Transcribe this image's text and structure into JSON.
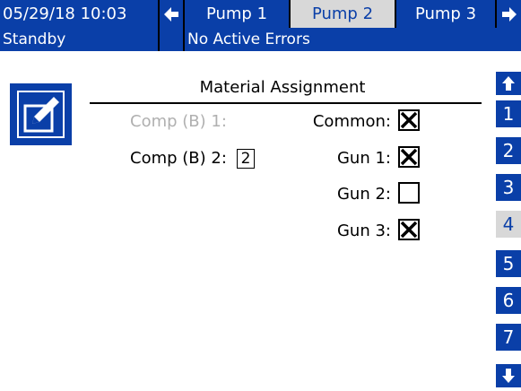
{
  "header": {
    "datetime": "05/29/18 10:03",
    "tabs": [
      {
        "label": "Pump 1",
        "active": false
      },
      {
        "label": "Pump 2",
        "active": true
      },
      {
        "label": "Pump 3",
        "active": false
      }
    ]
  },
  "status": {
    "mode": "Standby",
    "errors": "No Active Errors"
  },
  "page": {
    "title": "Material Assignment"
  },
  "fields": {
    "comp_b1_label": "Comp (B) 1:",
    "comp_b2_label": "Comp (B) 2:",
    "comp_b2_value": "2",
    "common_label": "Common:",
    "gun1_label": "Gun 1:",
    "gun2_label": "Gun 2:",
    "gun3_label": "Gun 3:"
  },
  "checks": {
    "common": true,
    "gun1": true,
    "gun2": false,
    "gun3": true
  },
  "rail": {
    "pages": [
      "1",
      "2",
      "3",
      "4",
      "5",
      "6",
      "7"
    ],
    "active_page": "4"
  },
  "colors": {
    "accent": "#0a3fa8",
    "active_tab_bg": "#d8d8d8",
    "disabled_text": "#b0b0b0"
  },
  "icons": [
    "arrow-left-icon",
    "arrow-right-icon",
    "arrow-up-icon",
    "arrow-down-icon",
    "edit-icon",
    "check-x-icon"
  ]
}
